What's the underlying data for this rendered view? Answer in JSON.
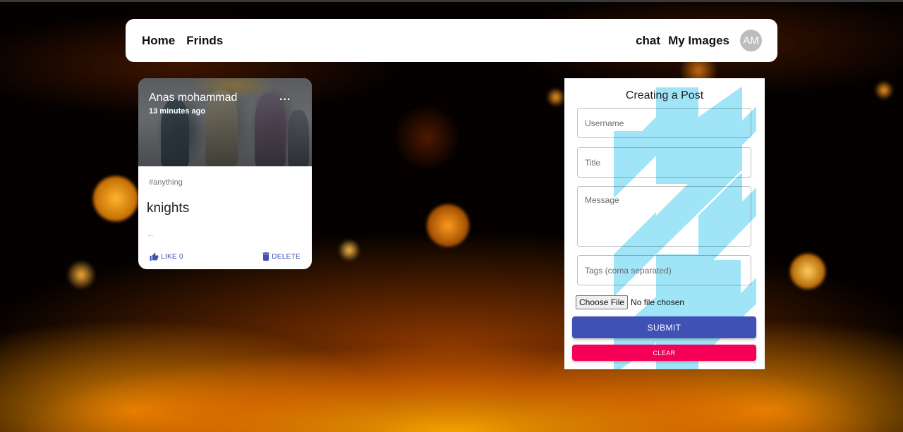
{
  "navbar": {
    "left_links": [
      "Home",
      "Frinds"
    ],
    "right_links": [
      "chat",
      "My Images"
    ],
    "avatar_initials": "AM"
  },
  "post": {
    "author": "Anas mohammad",
    "time": "13 minutes ago",
    "more": "...",
    "tags": "#anything",
    "title": "knights",
    "message": "...",
    "like_label": "LIKE 0",
    "delete_label": "DELETE"
  },
  "form": {
    "title": "Creating a Post",
    "username_placeholder": "Username",
    "title_placeholder": "Title",
    "message_placeholder": "Message",
    "tags_placeholder": "Tags (coma separated)",
    "file_button": "Choose File",
    "file_status": "No file chosen",
    "submit_label": "SUBMIT",
    "clear_label": "CLEAR"
  },
  "colors": {
    "primary": "#3f51b5",
    "secondary": "#f50057",
    "form_pattern": "#a0e4f8",
    "avatar_bg": "#bdbdbd"
  }
}
